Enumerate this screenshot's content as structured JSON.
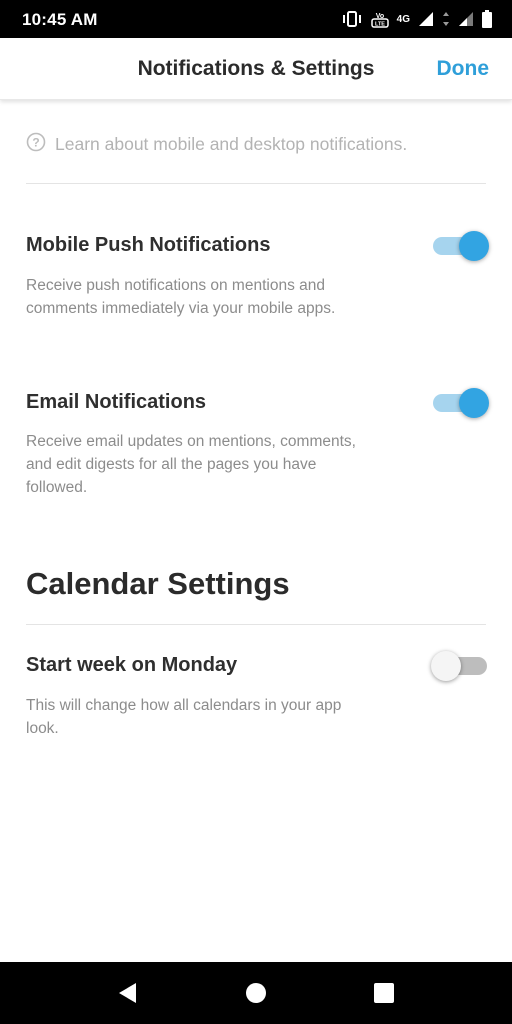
{
  "status_bar": {
    "time": "10:45 AM",
    "network_label": "4G",
    "icons": [
      "vibrate-icon",
      "volte-icon",
      "signal-icon",
      "signal-icon",
      "battery-icon"
    ]
  },
  "header": {
    "title": "Notifications & Settings",
    "done_label": "Done"
  },
  "learn": {
    "icon": "help-circle-icon",
    "text": "Learn about mobile and desktop notifications."
  },
  "notifications": [
    {
      "title": "Mobile Push Notifications",
      "description": "Receive push notifications on mentions and comments immediately via your mobile apps.",
      "enabled": true
    },
    {
      "title": "Email Notifications",
      "description": "Receive email updates on mentions, comments, and edit digests for all the pages you have followed.",
      "enabled": true
    }
  ],
  "calendar": {
    "section_title": "Calendar Settings",
    "setting": {
      "title": "Start week on Monday",
      "description": "This will change how all calendars in your app look.",
      "enabled": false
    }
  },
  "nav": [
    "back-icon",
    "home-icon",
    "recents-icon"
  ],
  "colors": {
    "accent": "#2f9fd9",
    "toggle_on_knob": "#32a4e2",
    "toggle_on_track": "#a6d4ee",
    "toggle_off_track": "#bdbdbd"
  }
}
